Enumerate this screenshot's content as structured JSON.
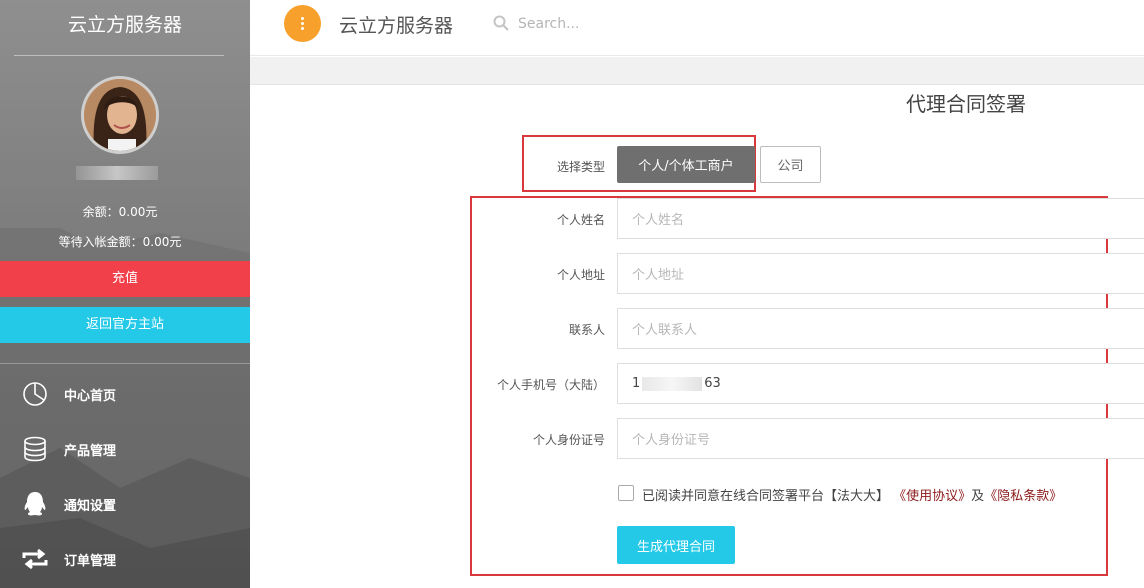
{
  "sidebar": {
    "brand": "云立方服务器",
    "balance_label": "余额：0.00元",
    "pending_label": "等待入帐金额：0.00元",
    "recharge": "充值",
    "back_home": "返回官方主站",
    "nav": [
      {
        "label": "中心首页",
        "icon": "pie-chart-icon"
      },
      {
        "label": "产品管理",
        "icon": "database-icon"
      },
      {
        "label": "通知设置",
        "icon": "qq-penguin-icon"
      },
      {
        "label": "订单管理",
        "icon": "swap-arrows-icon"
      }
    ]
  },
  "topbar": {
    "title": "云立方服务器",
    "search_placeholder": "Search..."
  },
  "main": {
    "page_title": "代理合同签署",
    "type_label": "选择类型",
    "type_options": [
      "个人/个体工商户",
      "公司"
    ],
    "type_selected": "个人/个体工商户",
    "fields": [
      {
        "label": "个人姓名",
        "placeholder": "个人姓名",
        "value": ""
      },
      {
        "label": "个人地址",
        "placeholder": "个人地址",
        "value": ""
      },
      {
        "label": "联系人",
        "placeholder": "个人联系人",
        "value": ""
      },
      {
        "label": "个人手机号（大陆）",
        "placeholder": "",
        "value_prefix": "1",
        "value_suffix": "63"
      },
      {
        "label": "个人身份证号",
        "placeholder": "个人身份证号",
        "value": ""
      }
    ],
    "agree_text": "已阅读并同意在线合同签署平台【法大大】",
    "agree_link1": "《使用协议》",
    "agree_and": "及",
    "agree_link2": "《隐私条款》",
    "submit": "生成代理合同"
  },
  "colors": {
    "accent_red": "#f2404b",
    "accent_cyan": "#25c9e8",
    "menu_orange": "#f7a12c",
    "highlight_box": "#d9393c"
  }
}
